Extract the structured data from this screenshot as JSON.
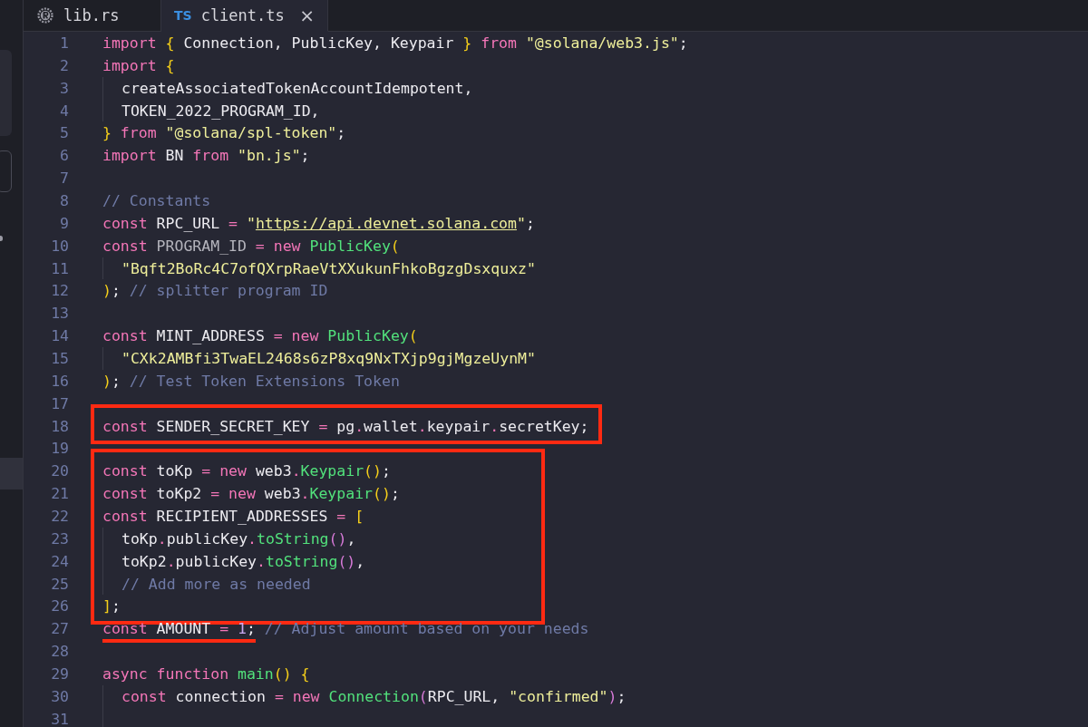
{
  "tabs": [
    {
      "label": "lib.rs",
      "selected": false
    },
    {
      "label": "client.ts",
      "icon_text": "TS",
      "close": "×",
      "selected": true
    }
  ],
  "code": [
    {
      "kind": "plain",
      "lines": [
        {
          "number": "1",
          "indented": false,
          "tokens": [
            {
              "kind": "keyword",
              "text": "import"
            },
            {
              "kind": "bracket",
              "text": "{",
              "gap": true
            },
            {
              "kind": "plain",
              "text": " Connection, PublicKey, Keypair "
            },
            {
              "kind": "bracket",
              "text": "}"
            },
            {
              "kind": "keyword",
              "text": "from",
              "gap": true
            },
            {
              "kind": "string",
              "text": "\"@solana/web3.js\"",
              "gap": true
            },
            {
              "kind": "plain",
              "text": ";"
            }
          ]
        },
        {
          "number": "2",
          "indented": false,
          "tokens": [
            {
              "kind": "keyword",
              "text": "import"
            },
            {
              "kind": "bracket",
              "text": "{",
              "gap": true
            }
          ]
        },
        {
          "number": "3",
          "indented": true,
          "tokens": [
            {
              "kind": "plain",
              "text": "createAssociatedTokenAccountIdempotent,"
            }
          ]
        },
        {
          "number": "4",
          "indented": true,
          "tokens": [
            {
              "kind": "plain",
              "text": "TOKEN_2022_PROGRAM_ID,"
            }
          ]
        },
        {
          "number": "5",
          "indented": false,
          "tokens": [
            {
              "kind": "bracket",
              "text": "}"
            },
            {
              "kind": "keyword",
              "text": "from",
              "gap": true
            },
            {
              "kind": "string",
              "text": "\"@solana/spl-token\"",
              "gap": true
            },
            {
              "kind": "plain",
              "text": ";"
            }
          ]
        },
        {
          "number": "6",
          "indented": false,
          "tokens": [
            {
              "kind": "keyword",
              "text": "import"
            },
            {
              "kind": "plain",
              "text": " BN "
            },
            {
              "kind": "keyword",
              "text": "from"
            },
            {
              "kind": "string",
              "text": "\"bn.js\"",
              "gap": true
            },
            {
              "kind": "plain",
              "text": ";"
            }
          ]
        },
        {
          "number": "7",
          "indented": false
        },
        {
          "number": "8",
          "indented": false,
          "tokens": [
            {
              "kind": "comment",
              "text": "// Constants"
            }
          ]
        },
        {
          "number": "9",
          "indented": false,
          "tokens": [
            {
              "kind": "keyword",
              "text": "const"
            },
            {
              "kind": "plain",
              "text": " RPC_URL "
            },
            {
              "kind": "operator",
              "text": "="
            },
            {
              "kind": "string",
              "text": "\"",
              "gap": true
            },
            {
              "kind": "url",
              "text": "https://api.devnet.solana.com"
            },
            {
              "kind": "string",
              "text": "\""
            },
            {
              "kind": "plain",
              "text": ";"
            }
          ]
        },
        {
          "number": "10",
          "indented": false,
          "tokens": [
            {
              "kind": "keyword",
              "text": "const"
            },
            {
              "kind": "dim",
              "text": "PROGRAM_ID",
              "gap": true
            },
            {
              "kind": "operator",
              "text": "=",
              "gap": true
            },
            {
              "kind": "keyword",
              "text": "new",
              "gap": true
            },
            {
              "kind": "function",
              "text": "PublicKey",
              "gap": true
            },
            {
              "kind": "bracket",
              "text": "("
            }
          ]
        },
        {
          "number": "11",
          "indented": true,
          "tokens": [
            {
              "kind": "string",
              "text": "\"Bqft2BoRc4C7ofQXrpRaeVtXXukunFhkoBgzgDsxquxz\""
            }
          ]
        },
        {
          "number": "12",
          "indented": false,
          "tokens": [
            {
              "kind": "bracket",
              "text": ")"
            },
            {
              "kind": "plain",
              "text": ";"
            },
            {
              "kind": "comment",
              "text": "// splitter program ID",
              "gap": true
            }
          ]
        },
        {
          "number": "13",
          "indented": false
        },
        {
          "number": "14",
          "indented": false,
          "tokens": [
            {
              "kind": "keyword",
              "text": "const"
            },
            {
              "kind": "plain",
              "text": " MINT_ADDRESS "
            },
            {
              "kind": "operator",
              "text": "="
            },
            {
              "kind": "keyword",
              "text": "new",
              "gap": true
            },
            {
              "kind": "function",
              "text": "PublicKey",
              "gap": true
            },
            {
              "kind": "bracket",
              "text": "("
            }
          ]
        },
        {
          "number": "15",
          "indented": true,
          "tokens": [
            {
              "kind": "string",
              "text": "\"CXk2AMBfi3TwaEL2468s6zP8xq9NxTXjp9gjMgzeUynM\""
            }
          ]
        },
        {
          "number": "16",
          "indented": false,
          "tokens": [
            {
              "kind": "bracket",
              "text": ")"
            },
            {
              "kind": "plain",
              "text": ";"
            },
            {
              "kind": "comment",
              "text": "// Test Token Extensions Token",
              "gap": true
            }
          ]
        },
        {
          "number": "17",
          "indented": false
        }
      ]
    },
    {
      "kind": "boxed",
      "lines": [
        {
          "number": "18",
          "indented": false,
          "tokens": [
            {
              "kind": "keyword",
              "text": "const"
            },
            {
              "kind": "plain",
              "text": " SENDER_SECRET_KEY "
            },
            {
              "kind": "operator",
              "text": "="
            },
            {
              "kind": "plain",
              "text": " pg"
            },
            {
              "kind": "operator",
              "text": "."
            },
            {
              "kind": "plain",
              "text": "wallet"
            },
            {
              "kind": "operator",
              "text": "."
            },
            {
              "kind": "plain",
              "text": "keypair"
            },
            {
              "kind": "operator",
              "text": "."
            },
            {
              "kind": "plain",
              "text": "secretKey;"
            }
          ]
        }
      ]
    },
    {
      "kind": "plain",
      "lines": [
        {
          "number": "19",
          "indented": false
        }
      ]
    },
    {
      "kind": "boxed",
      "lines": [
        {
          "number": "20",
          "indented": false,
          "tokens": [
            {
              "kind": "keyword",
              "text": "const"
            },
            {
              "kind": "plain",
              "text": " toKp "
            },
            {
              "kind": "operator",
              "text": "="
            },
            {
              "kind": "keyword",
              "text": "new",
              "gap": true
            },
            {
              "kind": "plain",
              "text": " web3"
            },
            {
              "kind": "operator",
              "text": "."
            },
            {
              "kind": "function",
              "text": "Keypair"
            },
            {
              "kind": "bracket",
              "text": "()"
            },
            {
              "kind": "plain",
              "text": ";"
            }
          ]
        },
        {
          "number": "21",
          "indented": false,
          "tokens": [
            {
              "kind": "keyword",
              "text": "const"
            },
            {
              "kind": "plain",
              "text": " toKp2 "
            },
            {
              "kind": "operator",
              "text": "="
            },
            {
              "kind": "keyword",
              "text": "new",
              "gap": true
            },
            {
              "kind": "plain",
              "text": " web3"
            },
            {
              "kind": "operator",
              "text": "."
            },
            {
              "kind": "function",
              "text": "Keypair"
            },
            {
              "kind": "bracket",
              "text": "()"
            },
            {
              "kind": "plain",
              "text": ";"
            }
          ]
        },
        {
          "number": "22",
          "indented": false,
          "tokens": [
            {
              "kind": "keyword",
              "text": "const"
            },
            {
              "kind": "plain",
              "text": " RECIPIENT_ADDRESSES "
            },
            {
              "kind": "operator",
              "text": "="
            },
            {
              "kind": "bracket",
              "text": "[",
              "gap": true
            }
          ]
        },
        {
          "number": "23",
          "indented": true,
          "tokens": [
            {
              "kind": "plain",
              "text": "toKp"
            },
            {
              "kind": "operator",
              "text": "."
            },
            {
              "kind": "plain",
              "text": "publicKey"
            },
            {
              "kind": "operator",
              "text": "."
            },
            {
              "kind": "function",
              "text": "toString"
            },
            {
              "kind": "paren",
              "text": "()"
            },
            {
              "kind": "plain",
              "text": ","
            }
          ]
        },
        {
          "number": "24",
          "indented": true,
          "tokens": [
            {
              "kind": "plain",
              "text": "toKp2"
            },
            {
              "kind": "operator",
              "text": "."
            },
            {
              "kind": "plain",
              "text": "publicKey"
            },
            {
              "kind": "operator",
              "text": "."
            },
            {
              "kind": "function",
              "text": "toString"
            },
            {
              "kind": "paren",
              "text": "()"
            },
            {
              "kind": "plain",
              "text": ","
            }
          ]
        },
        {
          "number": "25",
          "indented": true,
          "tokens": [
            {
              "kind": "comment",
              "text": "// Add more as needed"
            }
          ]
        },
        {
          "number": "26",
          "indented": false,
          "tokens": [
            {
              "kind": "bracket",
              "text": "]"
            },
            {
              "kind": "plain",
              "text": ";"
            }
          ]
        }
      ]
    },
    {
      "kind": "plain",
      "lines": [
        {
          "number": "27",
          "indented": false,
          "tokens": [
            {
              "kind": "keyword",
              "text": "const",
              "underlined": true
            },
            {
              "kind": "plain",
              "text": " AMOUNT ",
              "underlined": true
            },
            {
              "kind": "operator",
              "text": "=",
              "underlined": true
            },
            {
              "kind": "number",
              "text": "1",
              "gap": true,
              "underlined": true
            },
            {
              "kind": "plain",
              "text": ";",
              "underlined": true
            },
            {
              "kind": "comment",
              "text": "// Adjust amount based on your needs",
              "gap": true,
              "underlined": false
            }
          ]
        },
        {
          "number": "28",
          "indented": false
        },
        {
          "number": "29",
          "indented": false,
          "tokens": [
            {
              "kind": "keyword",
              "text": "async"
            },
            {
              "kind": "keyword",
              "text": "function",
              "gap": true
            },
            {
              "kind": "function",
              "text": "main",
              "gap": true
            },
            {
              "kind": "bracket",
              "text": "()"
            },
            {
              "kind": "bracket",
              "text": "{",
              "gap": true
            }
          ]
        },
        {
          "number": "30",
          "indented": true,
          "tokens": [
            {
              "kind": "keyword",
              "text": "const"
            },
            {
              "kind": "plain",
              "text": " connection "
            },
            {
              "kind": "operator",
              "text": "="
            },
            {
              "kind": "keyword",
              "text": "new",
              "gap": true
            },
            {
              "kind": "function",
              "text": "Connection",
              "gap": true
            },
            {
              "kind": "paren",
              "text": "("
            },
            {
              "kind": "plain",
              "text": "RPC_URL, "
            },
            {
              "kind": "string",
              "text": "\"confirmed\""
            },
            {
              "kind": "paren",
              "text": ")"
            },
            {
              "kind": "plain",
              "text": ";"
            }
          ]
        },
        {
          "number": "31",
          "indented": true
        }
      ]
    }
  ]
}
